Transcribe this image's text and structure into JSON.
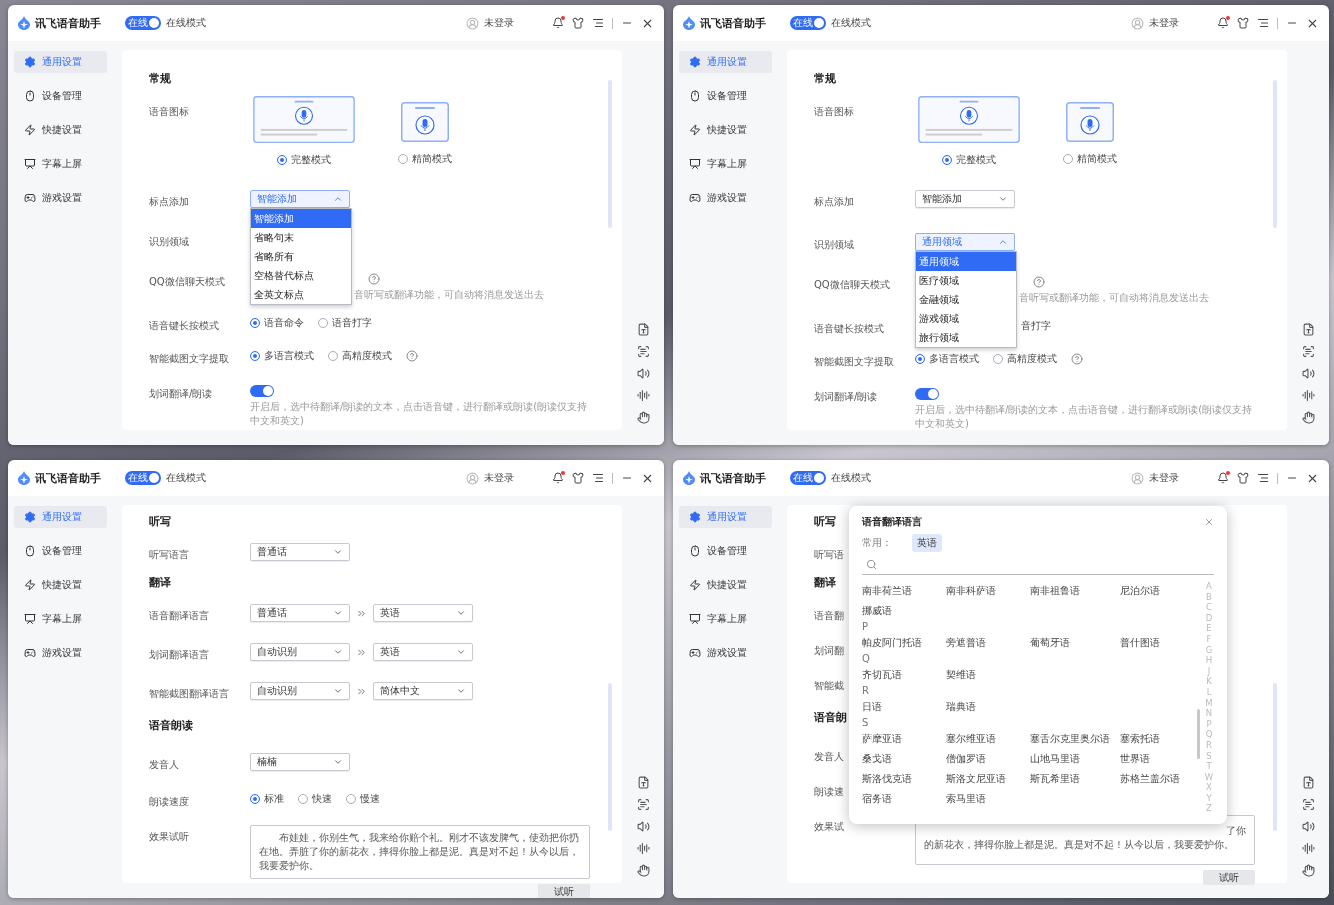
{
  "windows": [
    {
      "title": "讯飞语音助手",
      "online_badge": "在线",
      "online": true,
      "mode": "在线模式",
      "user": "未登录",
      "sidebar": [
        {
          "label": "通用设置",
          "selected": true
        },
        {
          "label": "设备管理",
          "selected": false
        },
        {
          "label": "快捷设置",
          "selected": false
        },
        {
          "label": "字幕上屏",
          "selected": false
        },
        {
          "label": "游戏设置",
          "selected": false
        }
      ],
      "content": {
        "kind": "general",
        "heading": "常规",
        "rows": [
          {
            "kind": "icon_style",
            "label": "语音图标",
            "options": [
              {
                "kind": "full",
                "label": "完整模式",
                "selected": true
              },
              {
                "kind": "compact",
                "label": "精简模式",
                "selected": false
              }
            ]
          },
          {
            "kind": "select",
            "label": "标点添加",
            "value": "智能添加",
            "expanded": true,
            "options": [
              {
                "label": "智能添加",
                "selected": true
              },
              {
                "label": "省略句末",
                "selected": false
              },
              {
                "label": "省略所有",
                "selected": false
              },
              {
                "label": "空格替代标点",
                "selected": false
              },
              {
                "label": "全英文标点",
                "selected": false
              }
            ]
          },
          {
            "kind": "label",
            "label": "识别领域"
          },
          {
            "kind": "help",
            "label": "QQ微信聊天模式",
            "hint": "音听写或翻译功能，可自动将消息发送出去"
          },
          {
            "kind": "radio",
            "label": "语音键长按模式",
            "options": [
              {
                "label": "语音命令",
                "selected": true
              },
              {
                "label": "语音打字",
                "selected": false
              }
            ]
          },
          {
            "kind": "radio",
            "label": "智能截图文字提取",
            "help": true,
            "options": [
              {
                "label": "多语言模式",
                "selected": true
              },
              {
                "label": "高精度模式",
                "selected": false
              }
            ]
          },
          {
            "kind": "toggle",
            "label": "划词翻译/朗读",
            "on": true,
            "hint": "开启后，选中待翻译/朗读的文本，点击语音键，进行翻译或朗读(朗读仅支持中文和英文)"
          }
        ]
      }
    },
    {
      "title": "讯飞语音助手",
      "online_badge": "在线",
      "online": true,
      "mode": "在线模式",
      "user": "未登录",
      "sidebar": [
        {
          "label": "通用设置",
          "selected": true
        },
        {
          "label": "设备管理",
          "selected": false
        },
        {
          "label": "快捷设置",
          "selected": false
        },
        {
          "label": "字幕上屏",
          "selected": false
        },
        {
          "label": "游戏设置",
          "selected": false
        }
      ],
      "content": {
        "kind": "general",
        "heading": "常规",
        "rows": [
          {
            "kind": "icon_style",
            "label": "语音图标",
            "options": [
              {
                "kind": "full",
                "label": "完整模式",
                "selected": true
              },
              {
                "kind": "compact",
                "label": "精简模式",
                "selected": false
              }
            ]
          },
          {
            "kind": "select",
            "label": "标点添加",
            "value": "智能添加",
            "expanded": false
          },
          {
            "kind": "select",
            "label": "识别领域",
            "value": "通用领域",
            "expanded": true,
            "options": [
              {
                "label": "通用领域",
                "selected": true
              },
              {
                "label": "医疗领域",
                "selected": false
              },
              {
                "label": "金融领域",
                "selected": false
              },
              {
                "label": "游戏领域",
                "selected": false
              },
              {
                "label": "旅行领域",
                "selected": false
              }
            ]
          },
          {
            "kind": "help",
            "label": "QQ微信聊天模式",
            "hint": "音听写或翻译功能，可自动将消息发送出去"
          },
          {
            "kind": "fragment",
            "label": "语音键长按模式",
            "text": "音打字"
          },
          {
            "kind": "radio",
            "label": "智能截图文字提取",
            "help": true,
            "options": [
              {
                "label": "多语言模式",
                "selected": true
              },
              {
                "label": "高精度模式",
                "selected": false
              }
            ]
          },
          {
            "kind": "toggle",
            "label": "划词翻译/朗读",
            "on": true,
            "hint": "开启后，选中待翻译/朗读的文本，点击语音键，进行翻译或朗读(朗读仅支持中文和英文)"
          }
        ]
      }
    },
    {
      "title": "讯飞语音助手",
      "online_badge": "在线",
      "online": true,
      "mode": "在线模式",
      "user": "未登录",
      "sidebar": [
        {
          "label": "通用设置",
          "selected": true
        },
        {
          "label": "设备管理",
          "selected": false
        },
        {
          "label": "快捷设置",
          "selected": false
        },
        {
          "label": "字幕上屏",
          "selected": false
        },
        {
          "label": "游戏设置",
          "selected": false
        }
      ],
      "content": {
        "kind": "dictation",
        "sections": [
          {
            "heading": "听写",
            "rows": [
              {
                "kind": "select",
                "label": "听写语言",
                "value": "普通话"
              }
            ]
          },
          {
            "heading": "翻译",
            "rows": [
              {
                "kind": "pair",
                "label": "语音翻译语言",
                "from": "普通话",
                "to": "英语"
              },
              {
                "kind": "pair",
                "label": "划词翻译语言",
                "from": "自动识别",
                "to": "英语"
              },
              {
                "kind": "pair",
                "label": "智能截图翻译语言",
                "from": "自动识别",
                "to": "简体中文"
              }
            ]
          },
          {
            "heading": "语音朗读",
            "rows": [
              {
                "kind": "select",
                "label": "发音人",
                "value": "楠楠"
              },
              {
                "kind": "radio",
                "label": "朗读速度",
                "options": [
                  {
                    "label": "标准",
                    "selected": true
                  },
                  {
                    "label": "快速",
                    "selected": false
                  },
                  {
                    "label": "慢速",
                    "selected": false
                  }
                ]
              },
              {
                "kind": "preview",
                "label": "效果试听",
                "text": "布娃娃，你别生气，我来给你赔个礼。刚才不该发脾气，使劲把你扔在地。弄脏了你的新花衣，摔得你脸上都是泥。真是对不起！从今以后，我要爱护你。",
                "button": "试听"
              }
            ]
          }
        ]
      }
    },
    {
      "title": "讯飞语音助手",
      "online_badge": "在线",
      "online": true,
      "mode": "在线模式",
      "user": "未登录",
      "sidebar": [
        {
          "label": "通用设置",
          "selected": true
        },
        {
          "label": "设备管理",
          "selected": false
        },
        {
          "label": "快捷设置",
          "selected": false
        },
        {
          "label": "字幕上屏",
          "selected": false
        },
        {
          "label": "游戏设置",
          "selected": false
        }
      ],
      "content": {
        "kind": "dictation",
        "sections": [
          {
            "heading": "听写",
            "rows": [
              {
                "kind": "label",
                "label": "听写语"
              }
            ]
          },
          {
            "heading": "翻译",
            "rows": [
              {
                "kind": "label",
                "label": "语音翻"
              },
              {
                "kind": "label",
                "label": "划词翻"
              },
              {
                "kind": "label",
                "label": "智能截"
              }
            ]
          },
          {
            "heading": "语音朗",
            "rows": [
              {
                "kind": "label",
                "label": "发音人"
              },
              {
                "kind": "label",
                "label": "朗读速"
              },
              {
                "kind": "preview_tail",
                "label": "效果试",
                "tail": "了你",
                "line": "的新花衣，摔得你脸上都是泥。真是对不起！从今以后，我要爱护你。",
                "button": "试听"
              }
            ]
          }
        ]
      },
      "dialog": {
        "title": "语音翻译语言",
        "common_label": "常用：",
        "common": [
          "英语"
        ],
        "groups": [
          {
            "items": [
              "南非荷兰语",
              "南非科萨语",
              "南非祖鲁语",
              "尼泊尔语",
              "挪威语"
            ]
          },
          {
            "letter": "P",
            "items": [
              "帕皮阿门托语",
              "旁遮普语",
              "葡萄牙语",
              "普什图语"
            ]
          },
          {
            "letter": "Q",
            "items": [
              "齐切瓦语",
              "契维语"
            ]
          },
          {
            "letter": "R",
            "items": [
              "日语",
              "瑞典语"
            ]
          },
          {
            "letter": "S",
            "items": [
              "萨摩亚语",
              "塞尔维亚语",
              "塞舌尔克里奥尔语",
              "塞索托语",
              "桑戈语",
              "僧伽罗语",
              "山地马里语",
              "世界语",
              "斯洛伐克语",
              "斯洛文尼亚语",
              "斯瓦希里语",
              "苏格兰盖尔语",
              "宿务语",
              "索马里语"
            ]
          }
        ],
        "index": [
          "A",
          "B",
          "C",
          "D",
          "E",
          "F",
          "G",
          "H",
          "J",
          "K",
          "L",
          "M",
          "N",
          "P",
          "Q",
          "R",
          "S",
          "T",
          "W",
          "X",
          "Y",
          "Z"
        ]
      }
    }
  ]
}
